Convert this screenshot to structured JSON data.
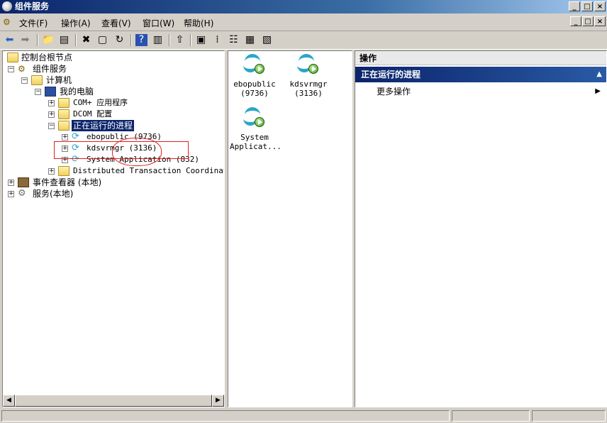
{
  "window": {
    "title": "组件服务",
    "buttons": {
      "minimize": "_",
      "maximize": "□",
      "close": "×"
    }
  },
  "menu": {
    "items": [
      "文件(F)",
      "操作(A)",
      "查看(V)",
      "窗口(W)",
      "帮助(H)"
    ]
  },
  "tree": {
    "nodes": [
      {
        "label": "控制台根节点",
        "expander": ""
      },
      {
        "label": "组件服务",
        "expander": "−"
      },
      {
        "label": "计算机",
        "expander": "−"
      },
      {
        "label": "我的电脑",
        "expander": "−"
      },
      {
        "label": "COM+ 应用程序",
        "expander": "+"
      },
      {
        "label": "DCOM 配置",
        "expander": "+"
      },
      {
        "label": "正在运行的进程",
        "expander": "−"
      },
      {
        "label": "ebopublic (9736)",
        "expander": "+"
      },
      {
        "label": "kdsvrmgr (3136)",
        "expander": "+"
      },
      {
        "label": "System Application (832)",
        "expander": "+"
      },
      {
        "label": "Distributed Transaction Coordinator",
        "expander": "+"
      },
      {
        "label": "事件查看器 (本地)",
        "expander": "+"
      },
      {
        "label": "服务(本地)",
        "expander": "+"
      }
    ]
  },
  "list": {
    "items": [
      {
        "name": "ebopublic",
        "pid": "(9736)"
      },
      {
        "name": "kdsvrmgr",
        "pid": "(3136)"
      },
      {
        "name": "System",
        "pid": "Applicat..."
      }
    ]
  },
  "actions": {
    "header": "操作",
    "section": "正在运行的进程",
    "section_caret": "▲",
    "more": "更多操作",
    "more_arrow": "▶"
  },
  "scroll": {
    "left": "◀",
    "right": "▶"
  }
}
